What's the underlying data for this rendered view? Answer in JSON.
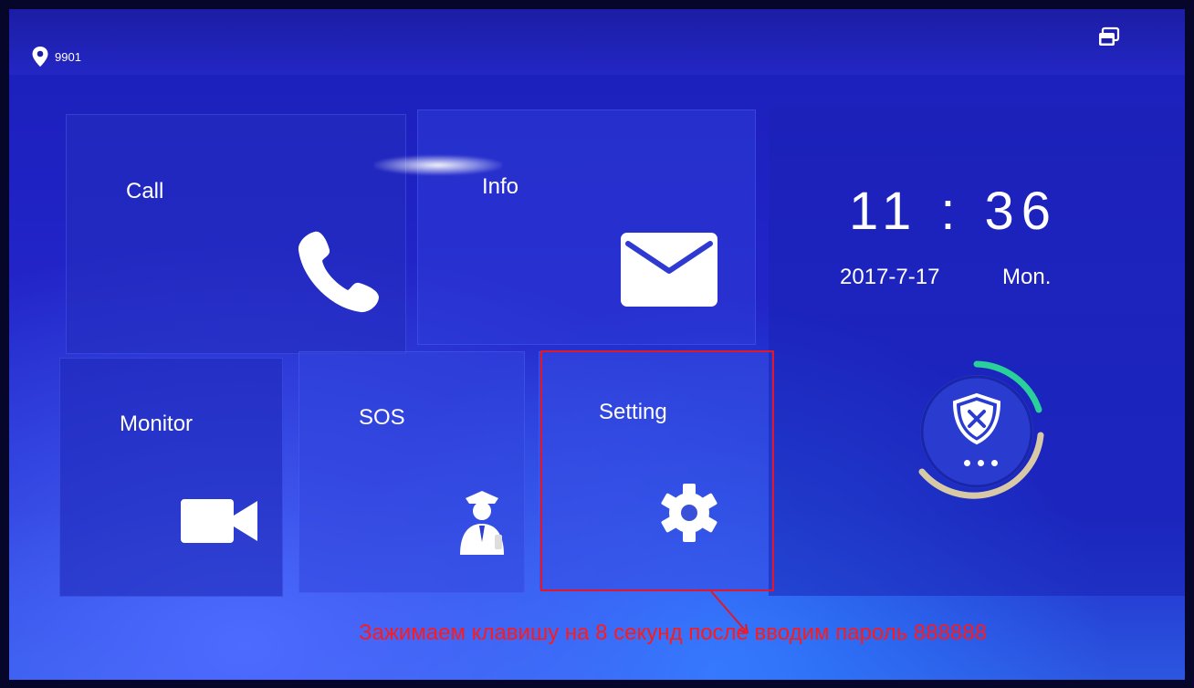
{
  "status_bar": {
    "room_number": "9901",
    "location_icon": "map-pin-icon",
    "screens_icon": "multi-window-icon"
  },
  "tiles": {
    "call": {
      "label": "Call",
      "icon": "phone-handset-icon"
    },
    "info": {
      "label": "Info",
      "icon": "envelope-icon"
    },
    "monitor": {
      "label": "Monitor",
      "icon": "video-camera-icon"
    },
    "sos": {
      "label": "SOS",
      "icon": "security-guard-icon"
    },
    "setting": {
      "label": "Setting",
      "icon": "gear-icon"
    }
  },
  "clock": {
    "time": "11 : 36",
    "date": "2017-7-17",
    "weekday": "Mon."
  },
  "arm_status": {
    "icon": "shield-x-icon",
    "more_icon": "ellipsis-icon"
  },
  "annotation": {
    "text": "Зажимаем клавишу на 8 секунд после вводим пароль 888888",
    "color": "#ff1a1a"
  },
  "colors": {
    "background": "#2224c8",
    "tile": "#2f3ad0",
    "highlight": "#e0192a"
  }
}
